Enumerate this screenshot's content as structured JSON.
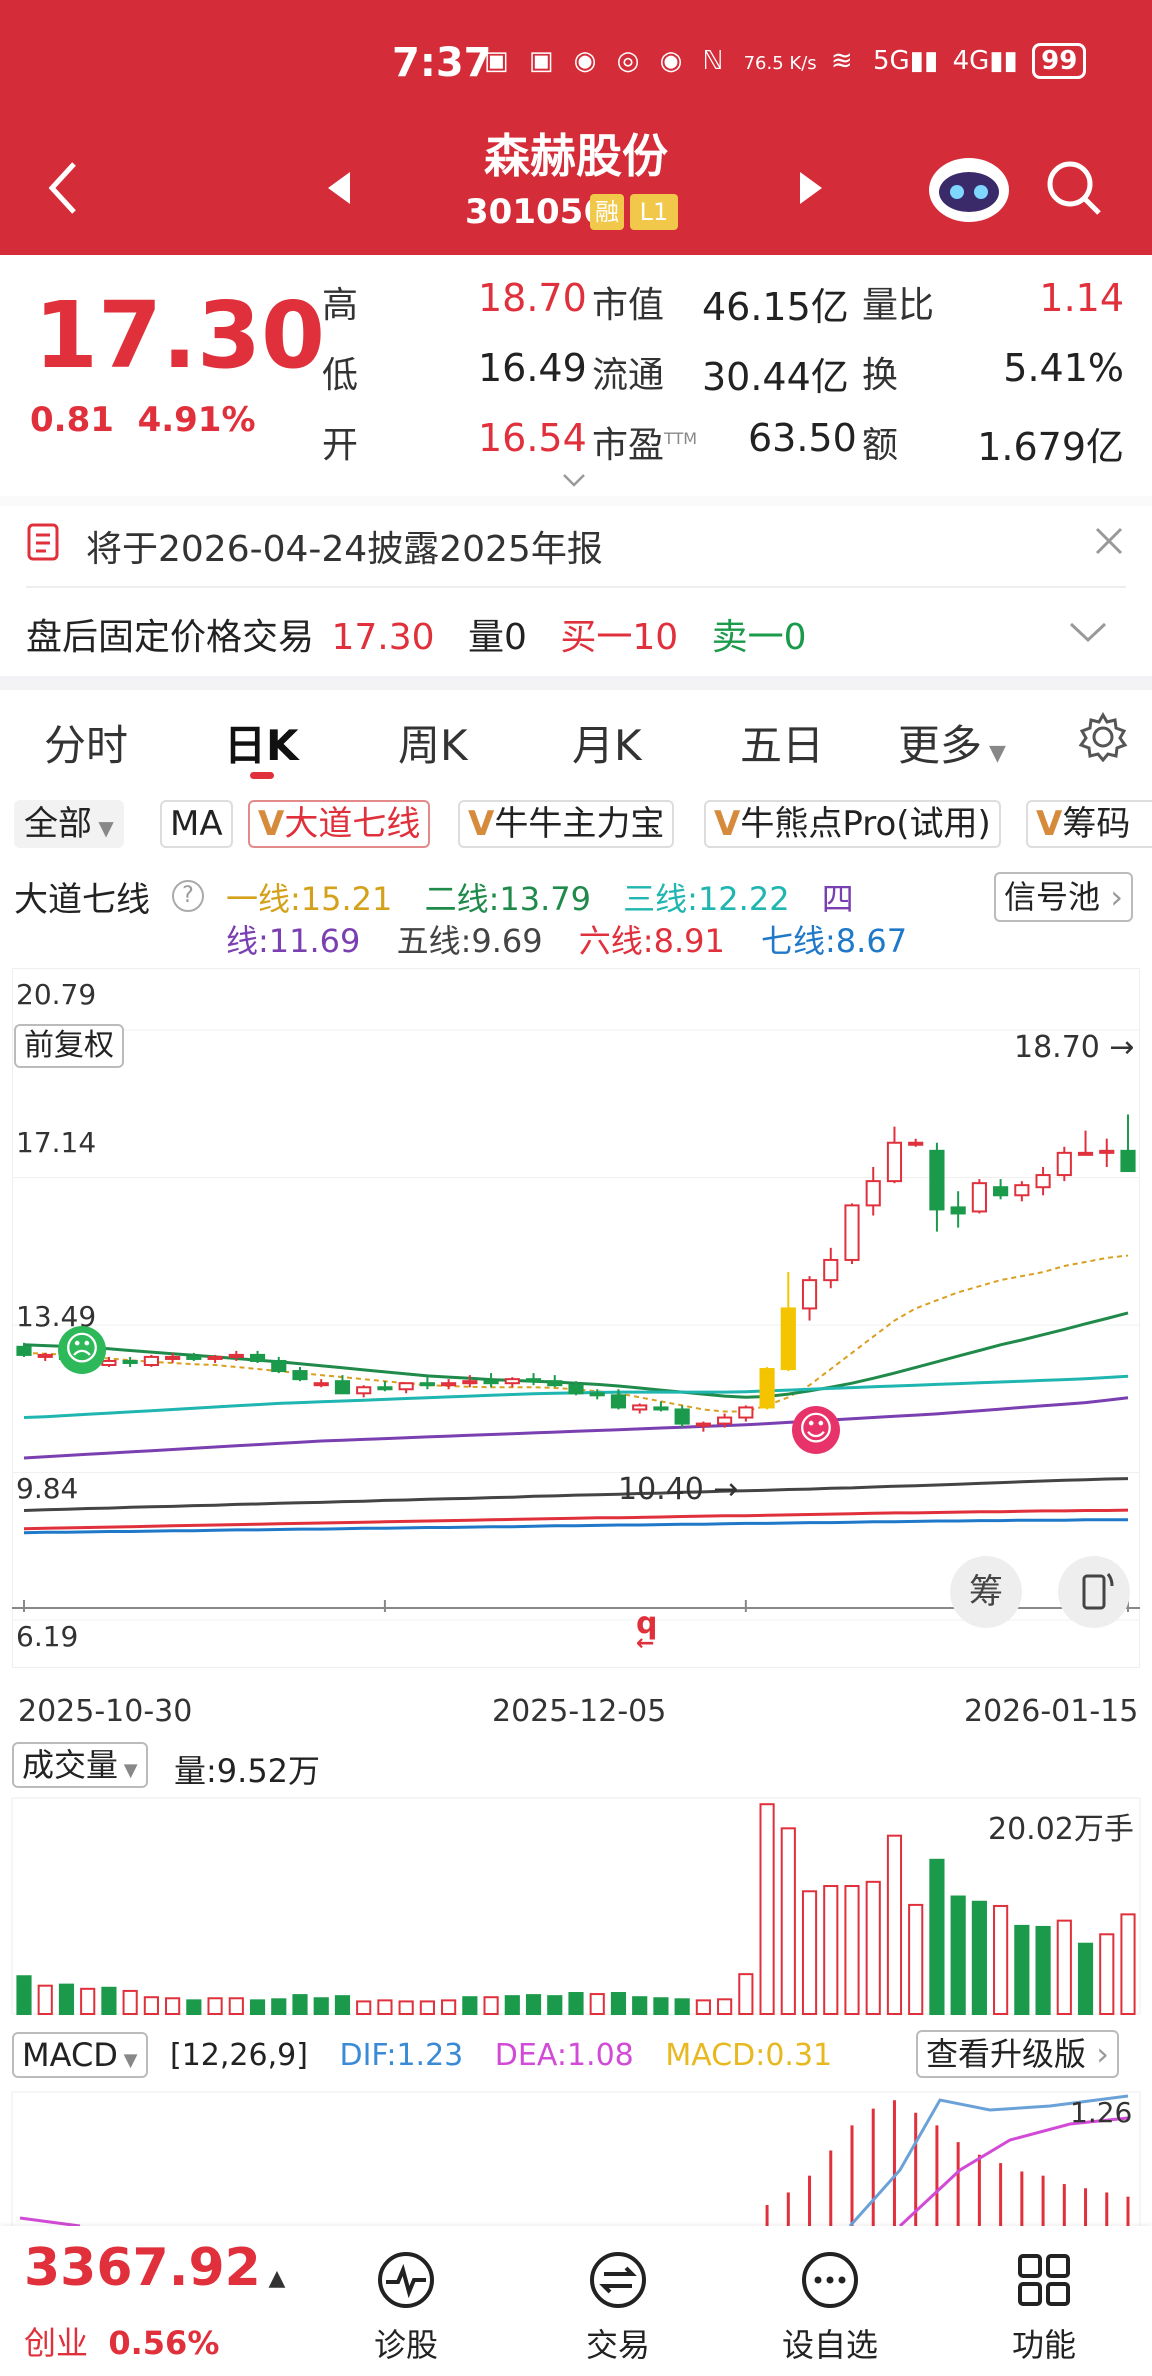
{
  "status_bar": {
    "time": "7:37",
    "net_speed": "76.5 K/s",
    "battery": "99"
  },
  "header": {
    "title": "森赫股份",
    "code": "301056",
    "tag_rong": "融",
    "tag_l1": "L1"
  },
  "quote": {
    "price": "17.30",
    "change": "0.81",
    "change_pct": "4.91%",
    "high_label": "高",
    "high": "18.70",
    "low_label": "低",
    "low": "16.49",
    "open_label": "开",
    "open": "16.54",
    "mcap_label": "市值",
    "mcap": "46.15亿",
    "float_label": "流通",
    "float": "30.44亿",
    "pe_label": "市盈",
    "pe_tm": "TTM",
    "pe": "63.50",
    "vr_label": "量比",
    "vr": "1.14",
    "turn_label": "换",
    "turn": "5.41%",
    "amt_label": "额",
    "amt": "1.679亿"
  },
  "notice": {
    "text": "将于2026-04-24披露2025年报"
  },
  "after_hours": {
    "label": "盘后固定价格交易",
    "price": "17.30",
    "vol": "量0",
    "buy": "买一10",
    "sell": "卖一0"
  },
  "tabs": [
    "分时",
    "日K",
    "周K",
    "月K",
    "五日",
    "更多"
  ],
  "indicators": {
    "all": "全部",
    "ma": "MA",
    "i1": "大道七线",
    "i2": "牛牛主力宝",
    "i3": "牛熊点Pro(试用)",
    "i4": "筹码"
  },
  "seven_lines": {
    "name": "大道七线",
    "l1": "一线:15.21",
    "l2": "二线:13.79",
    "l3": "三线:12.22",
    "l4a": "四",
    "l4b": "线:11.69",
    "l5": "五线:9.69",
    "l6": "六线:8.91",
    "l7": "七线:8.67",
    "signal": "信号池"
  },
  "kline": {
    "y_ticks": [
      "20.79",
      "17.14",
      "13.49",
      "9.84",
      "6.19"
    ],
    "adjust": "前复权",
    "high_mark": "18.70 →",
    "low_mark": "10.40 →",
    "q_mark": "q",
    "x_ticks": [
      "2025-10-30",
      "2025-12-05",
      "2026-01-15"
    ],
    "chip_btn": "筹"
  },
  "volume": {
    "label": "成交量",
    "value": "量:9.52万",
    "max_label": "20.02万手"
  },
  "macd": {
    "label": "MACD",
    "params": "[12,26,9]",
    "dif": "DIF:1.23",
    "dea": "DEA:1.08",
    "macd": "MACD:0.31",
    "upgrade": "查看升级版",
    "val": "1.26"
  },
  "index": {
    "value": "3367.92",
    "name": "创业",
    "pct": "0.56%"
  },
  "nav": [
    {
      "label": "诊股",
      "icon": "diagnose-icon"
    },
    {
      "label": "交易",
      "icon": "trade-icon"
    },
    {
      "label": "设自选",
      "icon": "watchlist-icon"
    },
    {
      "label": "功能",
      "icon": "grid-icon"
    }
  ],
  "chart_data": {
    "type": "candlestick",
    "y_axis_ticks": [
      20.79,
      17.14,
      13.49,
      9.84,
      6.19
    ],
    "ylim": [
      6.19,
      20.79
    ],
    "x_ticks": [
      "2025-10-30",
      "2025-12-05",
      "2026-01-15"
    ],
    "ohlc": [
      [
        12.95,
        13.05,
        12.7,
        12.75
      ],
      [
        12.7,
        12.8,
        12.6,
        12.75
      ],
      [
        12.75,
        12.8,
        12.55,
        12.65
      ],
      [
        12.6,
        12.7,
        12.4,
        12.5
      ],
      [
        12.5,
        12.7,
        12.45,
        12.6
      ],
      [
        12.6,
        12.7,
        12.45,
        12.55
      ],
      [
        12.5,
        12.75,
        12.45,
        12.7
      ],
      [
        12.65,
        12.8,
        12.55,
        12.7
      ],
      [
        12.7,
        12.8,
        12.6,
        12.65
      ],
      [
        12.65,
        12.75,
        12.55,
        12.7
      ],
      [
        12.7,
        12.85,
        12.6,
        12.75
      ],
      [
        12.75,
        12.85,
        12.55,
        12.6
      ],
      [
        12.6,
        12.7,
        12.3,
        12.35
      ],
      [
        12.35,
        12.45,
        12.1,
        12.15
      ],
      [
        12.05,
        12.15,
        11.95,
        12.05
      ],
      [
        12.1,
        12.25,
        11.8,
        11.8
      ],
      [
        11.8,
        12.0,
        11.7,
        11.95
      ],
      [
        11.95,
        12.1,
        11.85,
        11.9
      ],
      [
        11.9,
        12.05,
        11.8,
        12.05
      ],
      [
        12.05,
        12.2,
        11.9,
        12.0
      ],
      [
        12.0,
        12.15,
        11.9,
        12.05
      ],
      [
        12.05,
        12.25,
        11.95,
        12.1
      ],
      [
        12.1,
        12.3,
        11.95,
        12.05
      ],
      [
        12.05,
        12.2,
        11.95,
        12.15
      ],
      [
        12.15,
        12.3,
        12.0,
        12.1
      ],
      [
        12.1,
        12.25,
        11.95,
        12.0
      ],
      [
        12.0,
        12.1,
        11.75,
        11.8
      ],
      [
        11.8,
        11.9,
        11.65,
        11.75
      ],
      [
        11.75,
        11.9,
        11.4,
        11.45
      ],
      [
        11.4,
        11.55,
        11.3,
        11.5
      ],
      [
        11.45,
        11.6,
        11.35,
        11.4
      ],
      [
        11.4,
        11.5,
        10.95,
        11.05
      ],
      [
        11.0,
        11.1,
        10.85,
        11.05
      ],
      [
        11.05,
        11.3,
        10.95,
        11.2
      ],
      [
        11.2,
        11.5,
        11.1,
        11.45
      ],
      [
        11.45,
        12.45,
        11.4,
        12.4
      ],
      [
        12.4,
        14.8,
        12.35,
        13.9
      ],
      [
        13.9,
        14.7,
        13.6,
        14.6
      ],
      [
        14.6,
        15.4,
        14.4,
        15.1
      ],
      [
        15.1,
        16.5,
        15.0,
        16.45
      ],
      [
        16.45,
        17.4,
        16.2,
        17.05
      ],
      [
        17.05,
        18.4,
        17.0,
        18.0
      ],
      [
        18.0,
        18.1,
        17.9,
        18.0
      ],
      [
        17.8,
        18.0,
        15.8,
        16.35
      ],
      [
        16.4,
        16.8,
        15.9,
        16.25
      ],
      [
        16.3,
        17.1,
        16.25,
        17.0
      ],
      [
        16.9,
        17.1,
        16.6,
        16.7
      ],
      [
        16.7,
        17.05,
        16.55,
        16.95
      ],
      [
        16.9,
        17.4,
        16.7,
        17.2
      ],
      [
        17.2,
        17.9,
        17.05,
        17.75
      ],
      [
        17.75,
        18.3,
        17.7,
        17.75
      ],
      [
        17.75,
        18.1,
        17.4,
        17.8
      ],
      [
        17.8,
        18.7,
        17.6,
        17.3
      ]
    ],
    "volume": [
      [
        3.6,
        0
      ],
      [
        2.7,
        1
      ],
      [
        2.8,
        0
      ],
      [
        2.4,
        1
      ],
      [
        2.5,
        0
      ],
      [
        2.2,
        1
      ],
      [
        1.6,
        1
      ],
      [
        1.5,
        1
      ],
      [
        1.3,
        0
      ],
      [
        1.5,
        1
      ],
      [
        1.5,
        1
      ],
      [
        1.3,
        0
      ],
      [
        1.4,
        0
      ],
      [
        1.8,
        0
      ],
      [
        1.5,
        0
      ],
      [
        1.7,
        0
      ],
      [
        1.2,
        1
      ],
      [
        1.3,
        1
      ],
      [
        1.2,
        1
      ],
      [
        1.2,
        1
      ],
      [
        1.3,
        1
      ],
      [
        1.6,
        0
      ],
      [
        1.6,
        1
      ],
      [
        1.7,
        0
      ],
      [
        1.8,
        0
      ],
      [
        1.7,
        0
      ],
      [
        2.0,
        0
      ],
      [
        1.9,
        1
      ],
      [
        2.0,
        0
      ],
      [
        1.6,
        0
      ],
      [
        1.5,
        0
      ],
      [
        1.4,
        0
      ],
      [
        1.3,
        1
      ],
      [
        1.4,
        1
      ],
      [
        3.8,
        1
      ],
      [
        20.0,
        1
      ],
      [
        17.7,
        1
      ],
      [
        11.7,
        1
      ],
      [
        12.2,
        1
      ],
      [
        12.2,
        1
      ],
      [
        12.6,
        1
      ],
      [
        17.0,
        1
      ],
      [
        10.4,
        1
      ],
      [
        14.7,
        0
      ],
      [
        11.2,
        0
      ],
      [
        10.7,
        0
      ],
      [
        10.3,
        1
      ],
      [
        8.4,
        0
      ],
      [
        8.3,
        0
      ],
      [
        8.9,
        1
      ],
      [
        6.7,
        0
      ],
      [
        7.6,
        1
      ],
      [
        9.5,
        1
      ]
    ],
    "macd_bars": [
      0.05,
      0.08,
      0.12,
      0.18,
      0.24,
      0.28,
      0.3,
      0.27,
      0.24,
      0.2,
      0.17,
      0.15,
      0.13,
      0.12,
      0.1,
      0.09,
      0.08,
      0.07
    ],
    "lines": {
      "一线": [
        12.8,
        12.78,
        12.75,
        12.7,
        12.66,
        12.62,
        12.58,
        12.55,
        12.52,
        12.5,
        12.45,
        12.4,
        12.35,
        12.3,
        12.25,
        12.2,
        12.15,
        12.1,
        12.05,
        12.0,
        11.98,
        11.96,
        11.95,
        11.95,
        11.95,
        11.93,
        11.9,
        11.85,
        11.8,
        11.7,
        11.6,
        11.5,
        11.4,
        11.35,
        11.35,
        11.5,
        11.7,
        12.0,
        12.4,
        12.8,
        13.2,
        13.6,
        13.9,
        14.1,
        14.3,
        14.45,
        14.6,
        14.7,
        14.8,
        14.95,
        15.05,
        15.15,
        15.21
      ],
      "二线": [
        13.0,
        12.98,
        12.96,
        12.93,
        12.9,
        12.86,
        12.82,
        12.78,
        12.74,
        12.7,
        12.66,
        12.62,
        12.58,
        12.53,
        12.48,
        12.43,
        12.38,
        12.33,
        12.28,
        12.23,
        12.2,
        12.17,
        12.14,
        12.12,
        12.1,
        12.08,
        12.05,
        12.02,
        11.98,
        11.93,
        11.88,
        11.83,
        11.78,
        11.73,
        11.7,
        11.72,
        11.78,
        11.86,
        11.95,
        12.05,
        12.17,
        12.3,
        12.44,
        12.58,
        12.72,
        12.86,
        13.0,
        13.12,
        13.25,
        13.38,
        13.52,
        13.65,
        13.79
      ],
      "三线": [
        11.2,
        11.22,
        11.25,
        11.28,
        11.31,
        11.34,
        11.37,
        11.4,
        11.43,
        11.46,
        11.49,
        11.52,
        11.55,
        11.57,
        11.59,
        11.61,
        11.63,
        11.65,
        11.67,
        11.69,
        11.71,
        11.73,
        11.75,
        11.77,
        11.79,
        11.8,
        11.81,
        11.82,
        11.83,
        11.83,
        11.83,
        11.83,
        11.83,
        11.83,
        11.84,
        11.86,
        11.88,
        11.9,
        11.92,
        11.94,
        11.96,
        11.98,
        12.0,
        12.02,
        12.04,
        12.06,
        12.08,
        12.1,
        12.12,
        12.14,
        12.16,
        12.19,
        12.22
      ],
      "四线": [
        10.2,
        10.23,
        10.26,
        10.29,
        10.32,
        10.35,
        10.38,
        10.41,
        10.44,
        10.47,
        10.5,
        10.53,
        10.56,
        10.59,
        10.62,
        10.64,
        10.66,
        10.68,
        10.7,
        10.72,
        10.74,
        10.76,
        10.78,
        10.8,
        10.82,
        10.84,
        10.86,
        10.88,
        10.9,
        10.92,
        10.94,
        10.96,
        10.98,
        11.0,
        11.02,
        11.05,
        11.08,
        11.11,
        11.14,
        11.17,
        11.2,
        11.23,
        11.26,
        11.29,
        11.33,
        11.37,
        11.41,
        11.45,
        11.49,
        11.53,
        11.57,
        11.63,
        11.69
      ],
      "五线": [
        8.9,
        8.92,
        8.93,
        8.95,
        8.96,
        8.98,
        8.99,
        9.0,
        9.02,
        9.03,
        9.05,
        9.06,
        9.08,
        9.09,
        9.1,
        9.12,
        9.13,
        9.15,
        9.16,
        9.18,
        9.19,
        9.2,
        9.22,
        9.23,
        9.25,
        9.26,
        9.28,
        9.29,
        9.3,
        9.32,
        9.33,
        9.35,
        9.36,
        9.38,
        9.39,
        9.4,
        9.42,
        9.43,
        9.45,
        9.46,
        9.48,
        9.5,
        9.51,
        9.53,
        9.55,
        9.57,
        9.59,
        9.61,
        9.63,
        9.65,
        9.66,
        9.68,
        9.69
      ],
      "六线": [
        8.45,
        8.46,
        8.47,
        8.48,
        8.49,
        8.5,
        8.51,
        8.52,
        8.53,
        8.54,
        8.55,
        8.56,
        8.57,
        8.58,
        8.59,
        8.6,
        8.61,
        8.62,
        8.63,
        8.64,
        8.65,
        8.66,
        8.67,
        8.68,
        8.69,
        8.7,
        8.71,
        8.72,
        8.72,
        8.73,
        8.74,
        8.75,
        8.76,
        8.77,
        8.77,
        8.78,
        8.79,
        8.8,
        8.81,
        8.82,
        8.83,
        8.84,
        8.84,
        8.85,
        8.86,
        8.87,
        8.87,
        8.88,
        8.89,
        8.89,
        8.9,
        8.9,
        8.91
      ],
      "七线": [
        8.35,
        8.36,
        8.36,
        8.37,
        8.38,
        8.38,
        8.39,
        8.4,
        8.4,
        8.41,
        8.42,
        8.42,
        8.43,
        8.44,
        8.44,
        8.45,
        8.46,
        8.46,
        8.47,
        8.48,
        8.48,
        8.49,
        8.5,
        8.5,
        8.51,
        8.52,
        8.52,
        8.53,
        8.54,
        8.54,
        8.55,
        8.56,
        8.56,
        8.57,
        8.58,
        8.58,
        8.59,
        8.6,
        8.6,
        8.61,
        8.62,
        8.62,
        8.63,
        8.64,
        8.64,
        8.65,
        8.65,
        8.66,
        8.66,
        8.66,
        8.67,
        8.67,
        8.67
      ]
    }
  }
}
